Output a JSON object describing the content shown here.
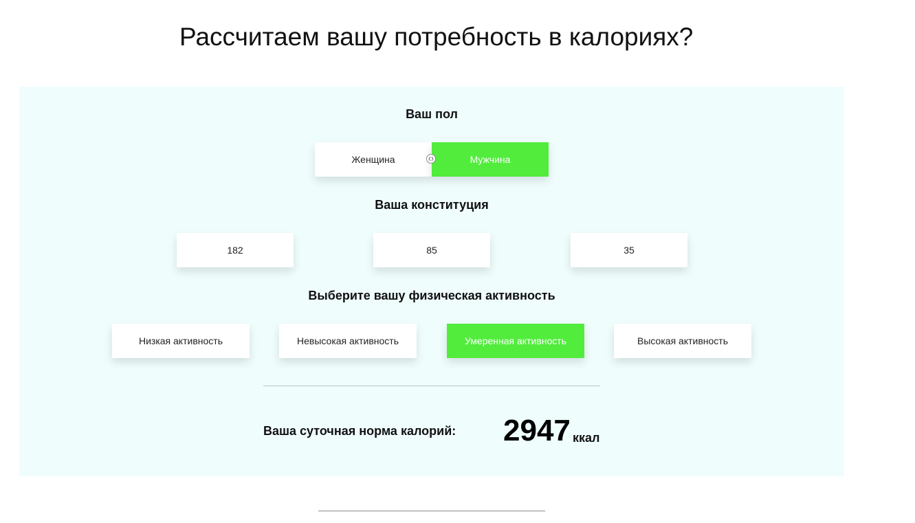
{
  "page": {
    "title": "Рассчитаем вашу потребность в калориях?"
  },
  "gender": {
    "label": "Ваш пол",
    "options": [
      "Женщина",
      "Мужчина"
    ],
    "selected": "Мужчина"
  },
  "constitution": {
    "label": "Ваша конституция",
    "values": [
      "182",
      "85",
      "35"
    ]
  },
  "activity": {
    "label": "Выберите вашу физическая активность",
    "options": [
      "Низкая активность",
      "Невысокая активность",
      "Умеренная активность",
      "Высокая активность"
    ],
    "selected": "Умеренная активность"
  },
  "result": {
    "label": "Ваша суточная норма калорий:",
    "value": "2947",
    "unit": "ккал"
  },
  "colors": {
    "accent": "#52ec3d",
    "panel_bg": "#effdfd",
    "option_bg": "#ffffff"
  },
  "icons": {
    "toggle_handle": "drag-handle-icon"
  }
}
